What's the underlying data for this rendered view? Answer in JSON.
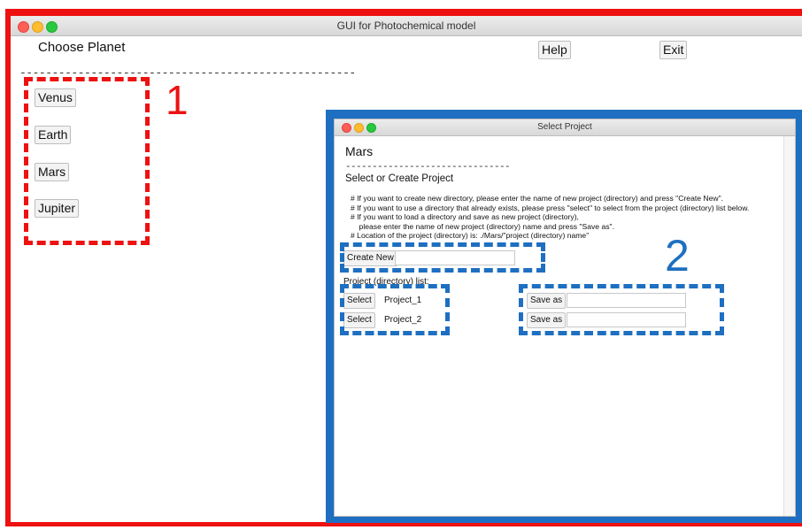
{
  "main_window": {
    "title": "GUI for Photochemical model",
    "choose_planet": "Choose Planet",
    "separator": "----------------------------------------------------",
    "help_label": "Help",
    "exit_label": "Exit",
    "planets": [
      "Venus",
      "Earth",
      "Mars",
      "Jupiter"
    ]
  },
  "project_window": {
    "title": "Select Project",
    "planet": "Mars",
    "separator": "-------------------------------",
    "heading": "Select or Create Project",
    "instructions": [
      "# If you want to create new directory, please enter the name of new project (directory) and press \"Create New\".",
      "# If you want to use a directory that already exists, please press \"select\" to select from the project (directory) list below.",
      "# If you want to load a directory and save as new project (directory),",
      "    please enter the name of new project (directory) name and press \"Save as\".",
      "# Location of the project (directory) is: ./Mars/\"project (directory) name\""
    ],
    "create_new_label": "Create New",
    "create_new_value": "",
    "project_list_label": "Project (directory) list:",
    "projects": [
      {
        "select_label": "Select",
        "name": "Project_1",
        "save_as_label": "Save as",
        "save_as_value": ""
      },
      {
        "select_label": "Select",
        "name": "Project_2",
        "save_as_label": "Save as",
        "save_as_value": ""
      }
    ]
  },
  "annotations": {
    "label_1": "1",
    "label_2": "2"
  },
  "colors": {
    "highlight_red": "#ee1111",
    "highlight_blue": "#1e6fc1"
  }
}
